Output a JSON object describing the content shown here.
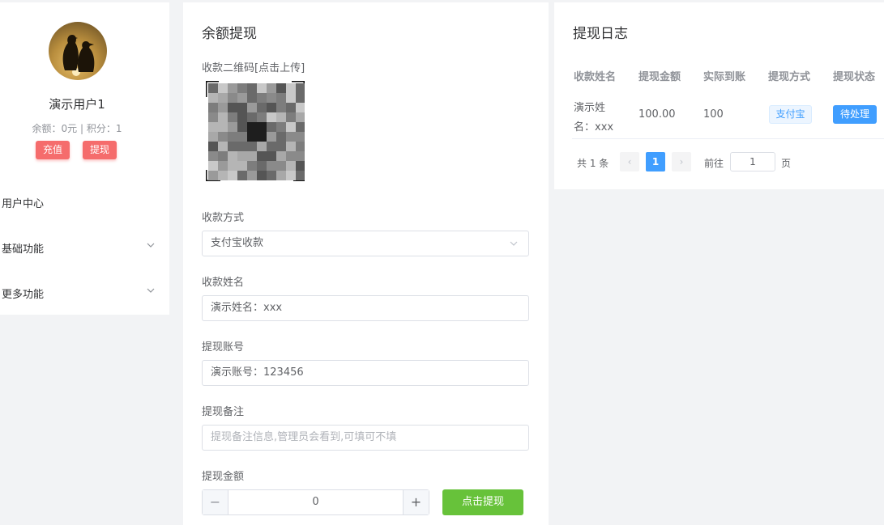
{
  "profile": {
    "username": "演示用户1",
    "balance_text": "余额：0元 | 积分：1",
    "recharge_label": "充值",
    "withdraw_label": "提现"
  },
  "menu": {
    "items": [
      {
        "label": "用户中心"
      },
      {
        "label": "基础功能"
      },
      {
        "label": "更多功能"
      }
    ]
  },
  "form": {
    "title": "余额提现",
    "qr_label": "收款二维码[点击上传]",
    "method_label": "收款方式",
    "method_value": "支付宝收款",
    "name_label": "收款姓名",
    "name_value": "演示姓名：xxx",
    "account_label": "提现账号",
    "account_value": "演示账号：123456",
    "remark_label": "提现备注",
    "remark_placeholder": "提现备注信息,管理员会看到,可填可不填",
    "amount_label": "提现金额",
    "amount_value": "0",
    "stepper_minus": "−",
    "stepper_plus": "+",
    "submit_label": "点击提现"
  },
  "log": {
    "title": "提现日志",
    "columns": [
      "收款姓名",
      "提现金额",
      "实际到账",
      "提现方式",
      "提现状态"
    ],
    "rows": [
      {
        "name_line1": "演示姓",
        "name_line2": "名：xxx",
        "amount": "100.00",
        "actual": "100",
        "method": "支付宝",
        "status": "待处理"
      }
    ],
    "pagination": {
      "total_text": "共 1 条",
      "prev": "‹",
      "current": "1",
      "next": "›",
      "goto_label": "前往",
      "goto_value": "1",
      "page_suffix": "页"
    }
  },
  "colors": {
    "primary": "#409eff",
    "success": "#67c23a",
    "danger": "#f56c6c"
  }
}
